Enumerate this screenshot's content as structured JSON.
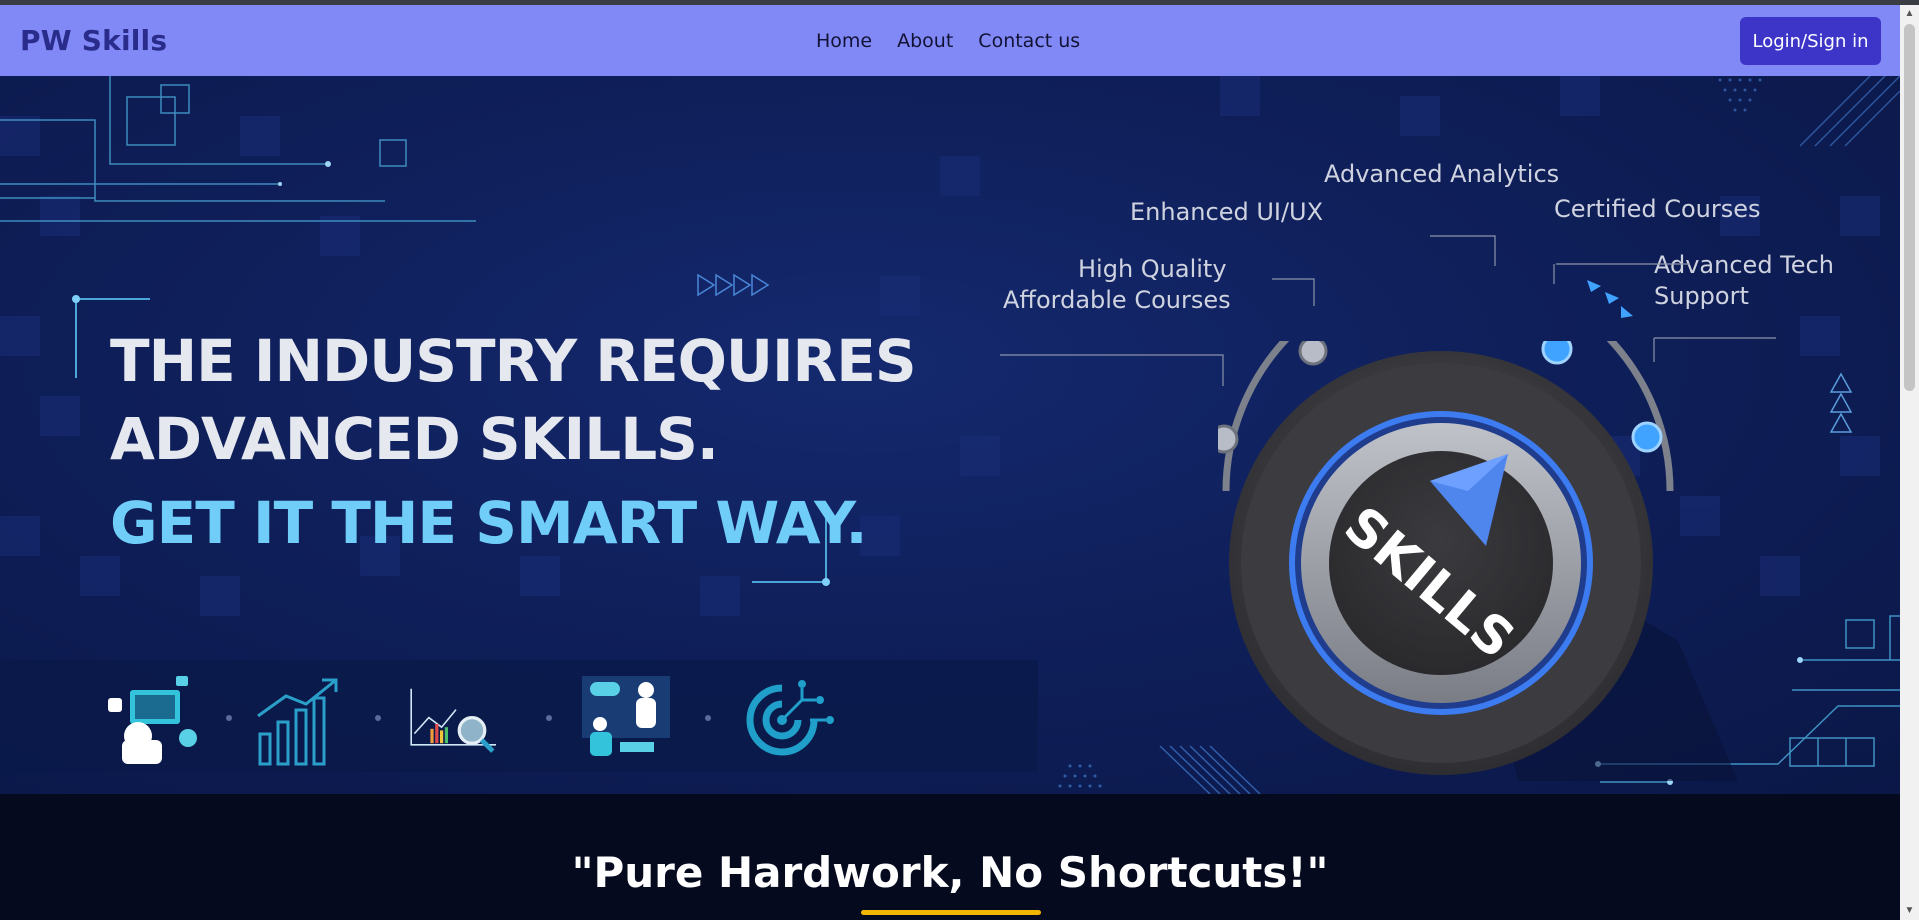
{
  "navbar": {
    "brand": "PW Skills",
    "links": [
      "Home",
      "About",
      "Contact us"
    ],
    "login_label": "Login/Sign in"
  },
  "hero": {
    "headline_line1": "THE INDUSTRY REQUIRES",
    "headline_line2": "ADVANCED SKILLS.",
    "headline_accent": "GET IT THE SMART WAY.",
    "dial_text": "SKILLS",
    "features": {
      "f1_line1": "High Quality",
      "f1_line2": "Affordable Courses",
      "f2": "Enhanced UI/UX",
      "f3": "Advanced Analytics",
      "f4": "Certified Courses",
      "f5_line1": "Advanced Tech",
      "f5_line2": "Support"
    },
    "strip_icons": [
      "developer-icon",
      "growth-chart-icon",
      "analytics-magnifier-icon",
      "team-meeting-icon",
      "target-icon"
    ]
  },
  "motto": "\"Pure Hardwork, No Shortcuts!\"",
  "colors": {
    "navbar_bg": "#8189f7",
    "login_bg": "#3d35c8",
    "accent_text": "#6fcdf8",
    "underline": "#f2b705"
  }
}
